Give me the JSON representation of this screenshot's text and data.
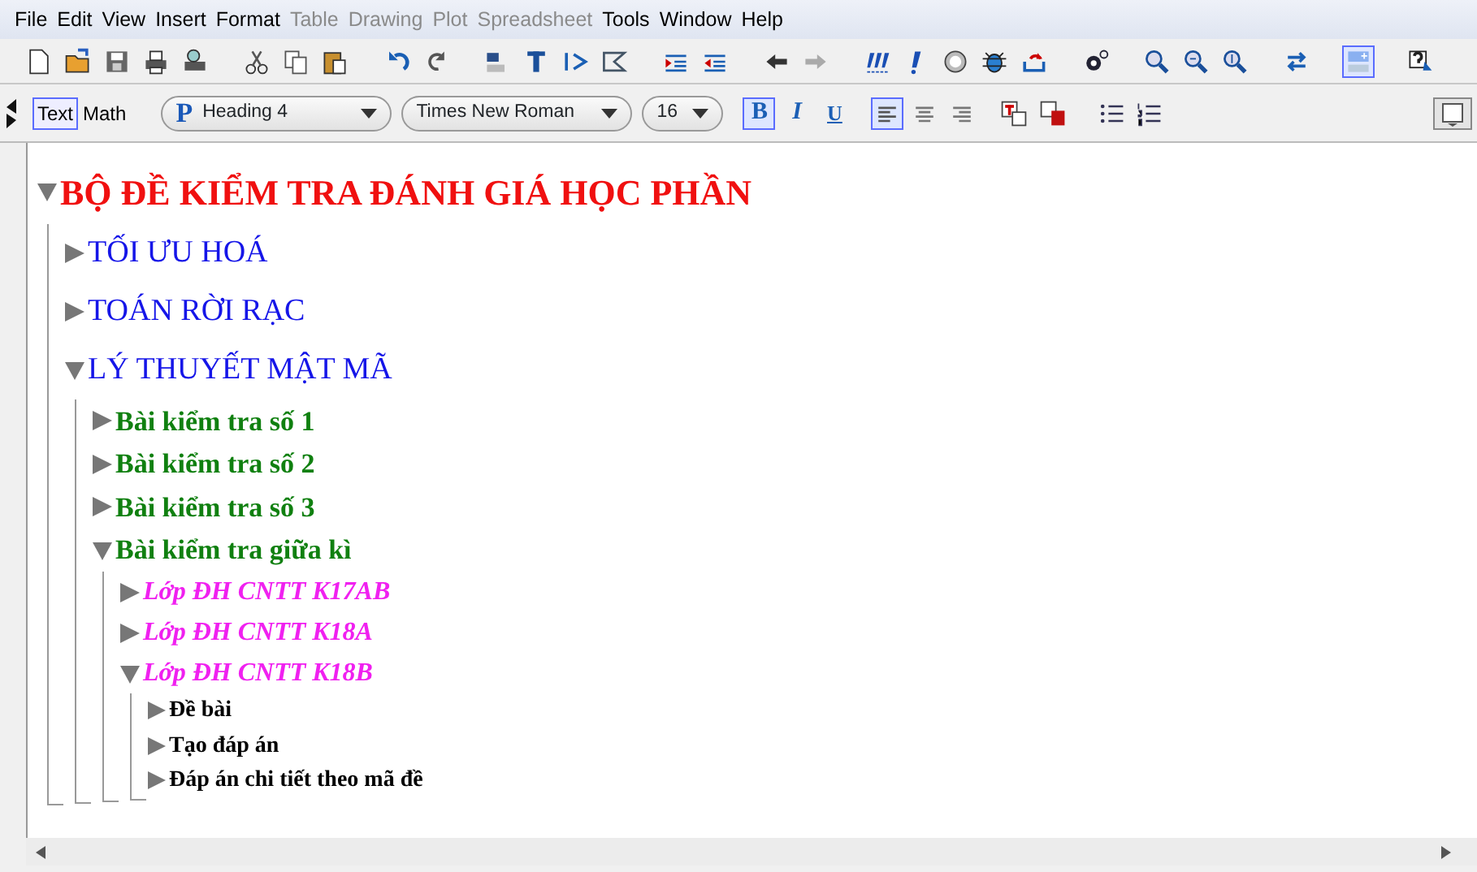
{
  "menu": [
    {
      "label": "File",
      "disabled": false
    },
    {
      "label": "Edit",
      "disabled": false
    },
    {
      "label": "View",
      "disabled": false
    },
    {
      "label": "Insert",
      "disabled": false
    },
    {
      "label": "Format",
      "disabled": false
    },
    {
      "label": "Table",
      "disabled": true
    },
    {
      "label": "Drawing",
      "disabled": true
    },
    {
      "label": "Plot",
      "disabled": true
    },
    {
      "label": "Spreadsheet",
      "disabled": true
    },
    {
      "label": "Tools",
      "disabled": false
    },
    {
      "label": "Window",
      "disabled": false
    },
    {
      "label": "Help",
      "disabled": false
    }
  ],
  "navigation": [
    {
      "disabled": false
    },
    {
      "disabled": true
    }
  ],
  "layout_toggle": {
    "selected": true
  },
  "mode_toggle": [
    {
      "label": "Text",
      "selected": true
    },
    {
      "label": "Math",
      "selected": false
    }
  ],
  "paragraph_style": {
    "marker": "P",
    "value": "Heading 4"
  },
  "font": {
    "value": "Times New Roman"
  },
  "font_size": {
    "value": "16"
  },
  "format_buttons": [
    {
      "label": "B",
      "selected": true
    },
    {
      "label": "I",
      "selected": false
    },
    {
      "label": "U",
      "selected": false
    }
  ],
  "alignment": [
    {
      "selected": true
    },
    {
      "selected": false
    },
    {
      "selected": false
    }
  ],
  "document": [
    {
      "kind": "title",
      "text": "BỘ ĐỀ KIỂM TRA ĐÁNH GIÁ HỌC PHẦN",
      "expanded": true,
      "children": [
        {
          "kind": "subject",
          "text": "TỐI ƯU HOÁ",
          "expanded": false
        },
        {
          "kind": "subject",
          "text": "TOÁN RỜI RẠC",
          "expanded": false
        },
        {
          "kind": "subject",
          "text": "LÝ THUYẾT MẬT MÃ",
          "expanded": true,
          "children": [
            {
              "kind": "test",
              "text": "Bài kiểm tra số 1",
              "expanded": false
            },
            {
              "kind": "test",
              "text": "Bài kiểm tra số 2",
              "expanded": false
            },
            {
              "kind": "test",
              "text": "Bài kiểm tra số 3",
              "expanded": false
            },
            {
              "kind": "test",
              "text": "Bài kiểm tra giữa kì",
              "expanded": true,
              "children": [
                {
                  "kind": "class",
                  "text": "Lớp ĐH CNTT K17AB",
                  "expanded": false
                },
                {
                  "kind": "class",
                  "text": "Lớp ĐH CNTT K18A",
                  "expanded": false
                },
                {
                  "kind": "class",
                  "text": "Lớp ĐH CNTT K18B",
                  "expanded": true,
                  "children": [
                    {
                      "kind": "part",
                      "text": "Đề bài",
                      "expanded": false
                    },
                    {
                      "kind": "part",
                      "text": "Tạo đáp án",
                      "expanded": false
                    },
                    {
                      "kind": "part",
                      "text": "Đáp án chi tiết theo mã đề",
                      "expanded": false
                    }
                  ]
                }
              ]
            }
          ]
        }
      ]
    }
  ]
}
